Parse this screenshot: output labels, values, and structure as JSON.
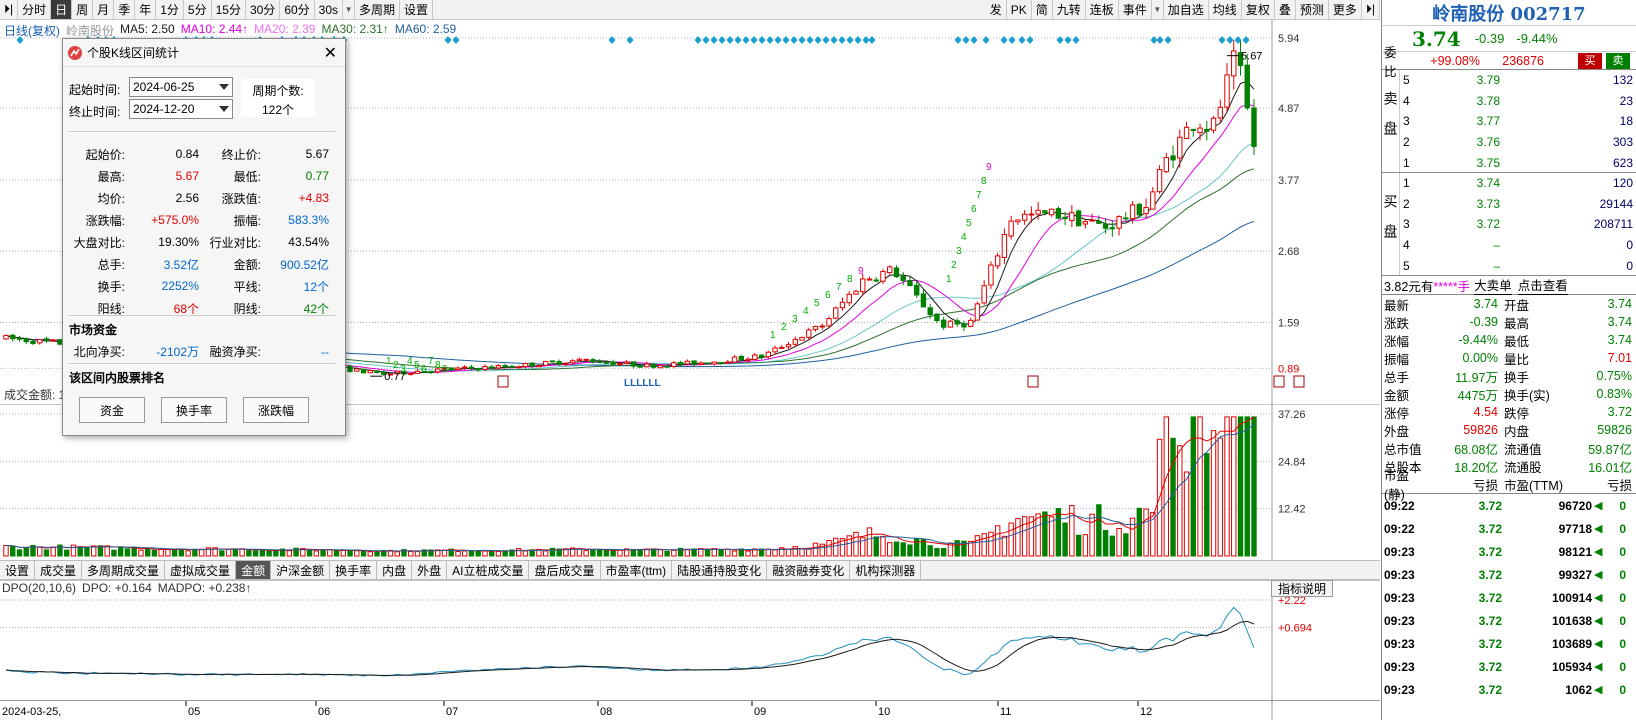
{
  "toolbar": {
    "periods": [
      "分时",
      "日",
      "周",
      "月",
      "季",
      "年",
      "1分",
      "5分",
      "15分",
      "30分",
      "60分",
      "30s",
      "多周期",
      "设置"
    ],
    "active_period": "日",
    "right_tools": [
      "发",
      "PK",
      "简",
      "九转",
      "连板",
      "事件",
      "加自选",
      "均线",
      "复权",
      "预测",
      "叠",
      "预测",
      "更多"
    ]
  },
  "legend": {
    "mode": "日线(复权)",
    "name": "岭南股份",
    "ma5": "MA5: 2.50",
    "ma10": "MA10: 2.44↑",
    "ma20": "MA20: 2.39",
    "ma30": "MA30: 2.31↑",
    "ma60": "MA60: 2.59"
  },
  "price_axis": [
    "5.94",
    "4.87",
    "3.77",
    "2.68",
    "1.59",
    "0.89"
  ],
  "vol_axis": [
    "37.26",
    "24.84",
    "12.42"
  ],
  "vol_legend": "成交金额: 1",
  "ind_axis": [
    "+2.22",
    "+0.694"
  ],
  "ind_legend": {
    "name": "DPO(20,10,6)",
    "dpo": "DPO: +0.164",
    "madpo": "MADPO: +0.238↑"
  },
  "ind_help": "指标说明",
  "annotations": {
    "high": "5.67",
    "low": "0.77",
    "lllll": "LLLLLL",
    "bear_seq": [
      "1",
      "2",
      "3",
      "4",
      "5",
      "6",
      "7",
      "8",
      "9"
    ],
    "bull_seq": [
      "1",
      "2",
      "3",
      "4",
      "5",
      "6",
      "7",
      "8",
      "9"
    ]
  },
  "ind_tabs": [
    "设置",
    "成交量",
    "多周期成交量",
    "虚拟成交量",
    "金额",
    "沪深金额",
    "换手率",
    "内盘",
    "外盘",
    "AI立桩成交量",
    "盘后成交量",
    "市盈率(ttm)",
    "陆股通持股变化",
    "融资融券变化",
    "机构探测器"
  ],
  "ind_tab_active": "金额",
  "x_axis": {
    "start": "2024-03-25,",
    "months": [
      "05",
      "06",
      "07",
      "08",
      "09",
      "10",
      "11",
      "12"
    ]
  },
  "dialog": {
    "title": "个股K线区间统计",
    "start_label": "起始时间:",
    "start_value": "2024-06-25",
    "end_label": "终止时间:",
    "end_value": "2024-12-20",
    "period_label": "周期个数:",
    "period_value": "122个",
    "stats": [
      {
        "k": "起始价:",
        "v": "0.84",
        "vc": "",
        "k2": "终止价:",
        "v2": "5.67",
        "v2c": ""
      },
      {
        "k": "最高:",
        "v": "5.67",
        "vc": "red",
        "k2": "最低:",
        "v2": "0.77",
        "v2c": "green"
      },
      {
        "k": "均价:",
        "v": "2.56",
        "vc": "",
        "k2": "涨跌值:",
        "v2": "+4.83",
        "v2c": "red"
      },
      {
        "k": "涨跌幅:",
        "v": "+575.0%",
        "vc": "red",
        "k2": "振幅:",
        "v2": "583.3%",
        "v2c": "blue"
      },
      {
        "k": "大盘对比:",
        "v": "19.30%",
        "vc": "",
        "k2": "行业对比:",
        "v2": "43.54%",
        "v2c": ""
      },
      {
        "k": "总手:",
        "v": "3.52亿",
        "vc": "blue",
        "k2": "金额:",
        "v2": "900.52亿",
        "v2c": "blue"
      },
      {
        "k": "换手:",
        "v": "2252%",
        "vc": "blue",
        "k2": "平线:",
        "v2": "12个",
        "v2c": "blue"
      },
      {
        "k": "阳线:",
        "v": "68个",
        "vc": "red",
        "k2": "阴线:",
        "v2": "42个",
        "v2c": "green"
      }
    ],
    "capital_title": "市场资金",
    "north_label": "北向净买:",
    "north_value": "-2102万",
    "margin_label": "融资净买:",
    "margin_value": "--",
    "rank_title": "该区间内股票排名",
    "buttons": [
      "资金",
      "换手率",
      "涨跌幅"
    ]
  },
  "right_panel": {
    "title": "岭南股份 002717",
    "price": "3.74",
    "change": "-0.39",
    "pct": "-9.44%",
    "ratio_label": "委比",
    "ratio_value": "+99.08%",
    "ratio_diff": "236876",
    "buy_btn": "买",
    "sell_btn": "卖",
    "sell_side": "卖盘",
    "buy_side": "买盘",
    "asks": [
      {
        "n": "5",
        "p": "3.79",
        "v": "132"
      },
      {
        "n": "4",
        "p": "3.78",
        "v": "23"
      },
      {
        "n": "3",
        "p": "3.77",
        "v": "18"
      },
      {
        "n": "2",
        "p": "3.76",
        "v": "303"
      },
      {
        "n": "1",
        "p": "3.75",
        "v": "623"
      }
    ],
    "bids": [
      {
        "n": "1",
        "p": "3.74",
        "v": "120"
      },
      {
        "n": "2",
        "p": "3.73",
        "v": "29144"
      },
      {
        "n": "3",
        "p": "3.72",
        "v": "208711"
      },
      {
        "n": "4",
        "p": "–",
        "v": "0"
      },
      {
        "n": "5",
        "p": "–",
        "v": "0"
      }
    ],
    "big_order": {
      "a": "3.82元有",
      "b": "*****手",
      "c": "大卖单",
      "d": "点击查看"
    },
    "quote": [
      {
        "k": "最新",
        "v": "3.74",
        "vc": "green",
        "k2": "开盘",
        "v2": "3.74",
        "v2c": "green"
      },
      {
        "k": "涨跌",
        "v": "-0.39",
        "vc": "green",
        "k2": "最高",
        "v2": "3.74",
        "v2c": "green"
      },
      {
        "k": "涨幅",
        "v": "-9.44%",
        "vc": "green",
        "k2": "最低",
        "v2": "3.74",
        "v2c": "green"
      },
      {
        "k": "振幅",
        "v": "0.00%",
        "vc": "green",
        "k2": "量比",
        "v2": "7.01",
        "v2c": "red"
      },
      {
        "k": "总手",
        "v": "11.97万",
        "vc": "green",
        "k2": "换手",
        "v2": "0.75%",
        "v2c": "green"
      },
      {
        "k": "金额",
        "v": "4475万",
        "vc": "green",
        "k2": "换手(实)",
        "v2": "0.83%",
        "v2c": "green"
      },
      {
        "k": "涨停",
        "v": "4.54",
        "vc": "red",
        "k2": "跌停",
        "v2": "3.72",
        "v2c": "green"
      },
      {
        "k": "外盘",
        "v": "59826",
        "vc": "red",
        "k2": "内盘",
        "v2": "59826",
        "v2c": "green"
      },
      {
        "k": "总市值",
        "v": "68.08亿",
        "vc": "green",
        "k2": "流通值",
        "v2": "59.87亿",
        "v2c": "green"
      },
      {
        "k": "总股本",
        "v": "18.20亿",
        "vc": "green",
        "k2": "流通股",
        "v2": "16.01亿",
        "v2c": "green"
      },
      {
        "k": "市盈(静)",
        "v": "亏损",
        "vc": "",
        "k2": "市盈(TTM)",
        "v2": "亏损",
        "v2c": ""
      }
    ],
    "ticks": [
      {
        "t": "09:22",
        "p": "3.72",
        "v": "96720"
      },
      {
        "t": "09:22",
        "p": "3.72",
        "v": "97718"
      },
      {
        "t": "09:23",
        "p": "3.72",
        "v": "98121"
      },
      {
        "t": "09:23",
        "p": "3.72",
        "v": "99327"
      },
      {
        "t": "09:23",
        "p": "3.72",
        "v": "100914"
      },
      {
        "t": "09:23",
        "p": "3.72",
        "v": "101638"
      },
      {
        "t": "09:23",
        "p": "3.72",
        "v": "103689"
      },
      {
        "t": "09:23",
        "p": "3.72",
        "v": "105934"
      },
      {
        "t": "09:23",
        "p": "3.72",
        "v": "1062"
      }
    ],
    "tick_tail": "0"
  },
  "colors": {
    "up": "#e00000",
    "down": "#008000",
    "ma5": "#1a1a1a",
    "ma10": "#e000e0",
    "ma20": "#00a0a0",
    "ma30": "#2f6f2f",
    "ma60": "#2060a0"
  }
}
